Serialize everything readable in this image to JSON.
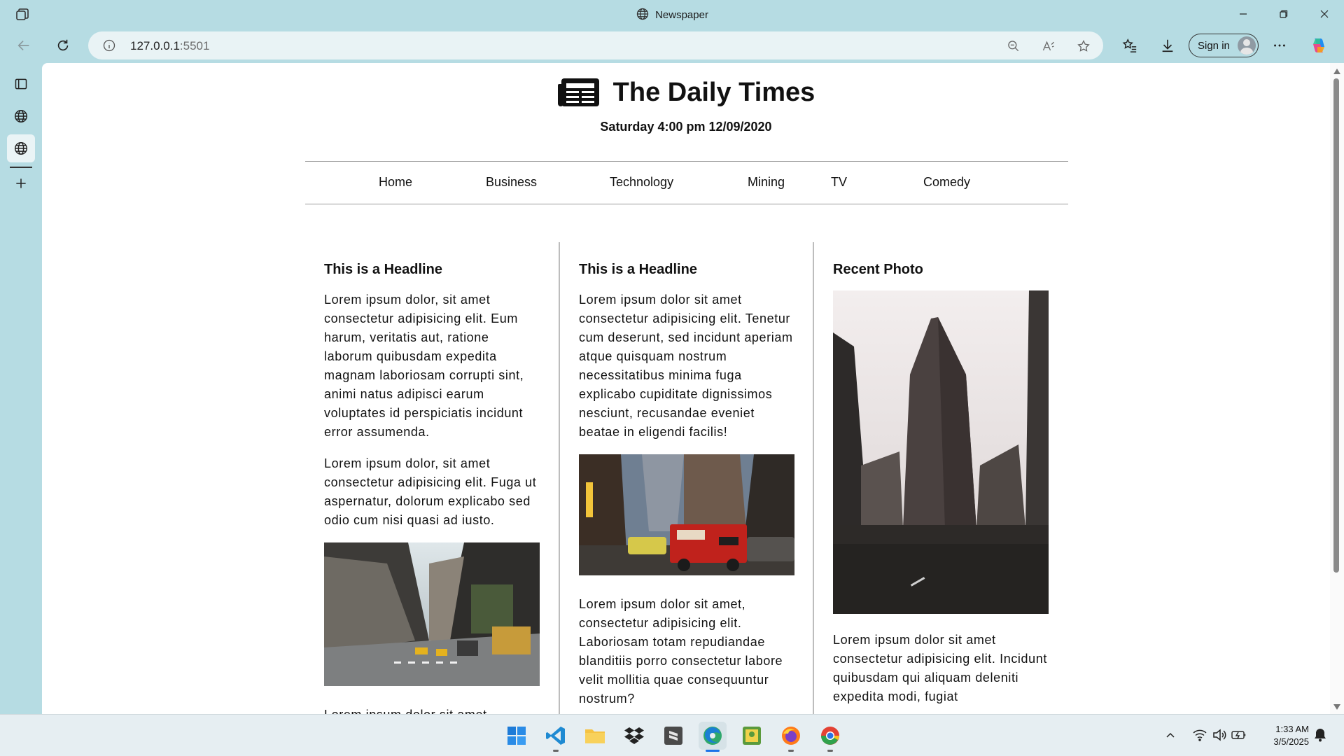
{
  "window": {
    "title": "Newspaper"
  },
  "browser": {
    "url_host": "127.0.0.1",
    "url_port": ":5501",
    "signin_label": "Sign in"
  },
  "page": {
    "site_title": "The Daily Times",
    "date_line": "Saturday 4:00 pm 12/09/2020",
    "nav": [
      {
        "label": "Home"
      },
      {
        "label": "Business"
      },
      {
        "label": "Technology"
      },
      {
        "label": "Mining"
      },
      {
        "label": "TV"
      },
      {
        "label": "Comedy"
      }
    ],
    "columns": [
      {
        "headline": "This is a Headline",
        "paragraphs": [
          "Lorem ipsum dolor, sit amet consectetur adipisicing elit. Eum harum, veritatis aut, ratione laborum quibusdam expedita magnam laboriosam corrupti sint, animi natus adipisci earum voluptates id perspiciatis incidunt error assumenda.",
          "Lorem ipsum dolor, sit amet consectetur adipisicing elit. Fuga ut aspernatur, dolorum explicabo sed odio cum nisi quasi ad iusto.",
          "Lorem ipsum dolor sit amet"
        ]
      },
      {
        "headline": "This is a Headline",
        "paragraphs": [
          "Lorem ipsum dolor sit amet consectetur adipisicing elit. Tenetur cum deserunt, sed incidunt aperiam atque quisquam nostrum necessitatibus minima fuga explicabo cupiditate dignissimos nesciunt, recusandae eveniet beatae in eligendi facilis!",
          "Lorem ipsum dolor sit amet, consectetur adipisicing elit. Laboriosam totam repudiandae blanditiis porro consectetur labore velit mollitia quae consequuntur nostrum?"
        ]
      },
      {
        "headline": "Recent Photo",
        "paragraphs": [
          "Lorem ipsum dolor sit amet consectetur adipisicing elit. Incidunt quibusdam qui aliquam deleniti expedita modi, fugiat"
        ]
      }
    ]
  },
  "taskbar": {
    "time": "1:33 AM",
    "date": "3/5/2025"
  },
  "icons": {
    "app": "tab-actions-icon",
    "globe": "globe-icon",
    "newspaper": "newspaper-icon"
  },
  "colors": {
    "chrome_bg": "#b6dce3",
    "address_bg": "#e9f3f5",
    "page_bg": "#ffffff",
    "divider": "#bdbdbd"
  }
}
